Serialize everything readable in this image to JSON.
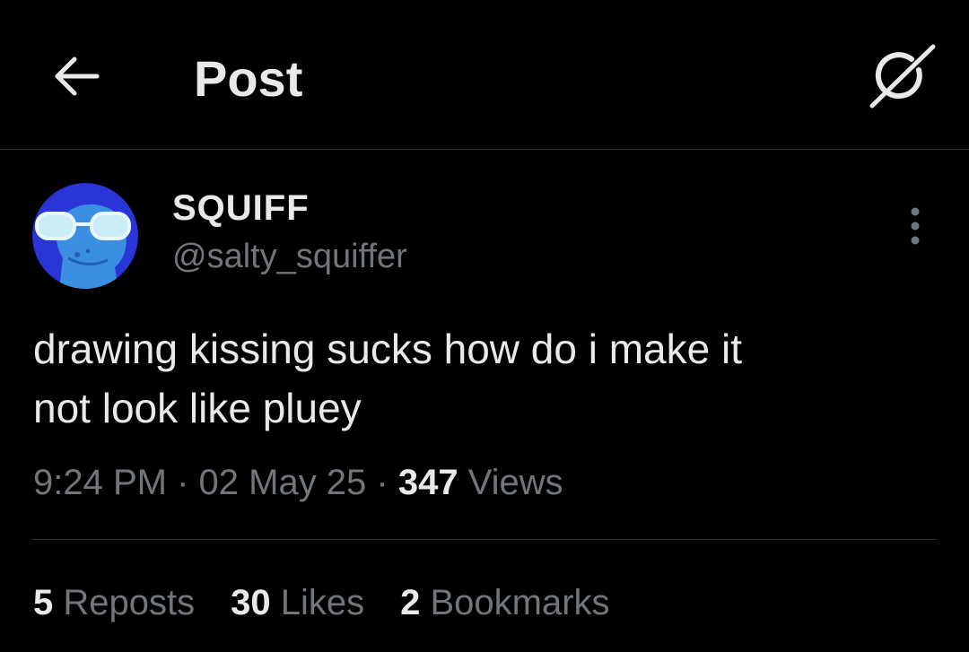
{
  "header": {
    "title": "Post",
    "back_icon": "arrow-left-icon",
    "grok_icon": "grok-icon"
  },
  "author": {
    "display_name": "SQUIFF",
    "handle": "@salty_squiffer",
    "avatar": "avatar-blue-character"
  },
  "more_icon": "more-vertical-icon",
  "tweet": {
    "text": "drawing kissing sucks how do i make it\nnot look like pluey"
  },
  "meta": {
    "time": "9:24 PM",
    "sep1": " · ",
    "date": "02 May 25",
    "sep2": " · ",
    "views_count": "347",
    "views_label": " Views"
  },
  "stats": {
    "reposts": {
      "count": "5",
      "label": " Reposts"
    },
    "likes": {
      "count": "30",
      "label": " Likes"
    },
    "bookmarks": {
      "count": "2",
      "label": " Bookmarks"
    }
  },
  "colors": {
    "background": "#000000",
    "text": "#e7e9ea",
    "secondary": "#71767b",
    "divider": "#2f3336",
    "avatar_bg": "#2a35d8",
    "avatar_char": "#3b8fe0"
  }
}
